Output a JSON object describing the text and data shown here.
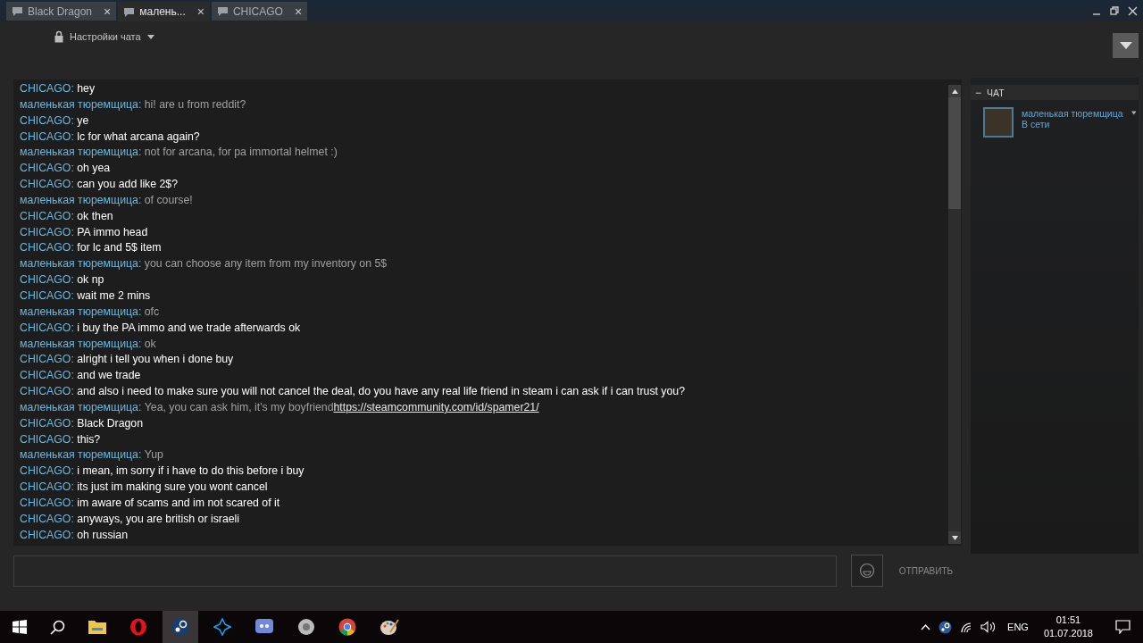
{
  "tabs": [
    {
      "label": "Black Dragon",
      "selected": false,
      "close": "×"
    },
    {
      "label": "малень...",
      "selected": true,
      "close": "×"
    },
    {
      "label": "CHICAGO",
      "selected": false,
      "close": "×"
    }
  ],
  "chat_settings": {
    "label": "Настройки чата"
  },
  "messages": [
    {
      "sender": "CHICAGO:",
      "kind": "incoming",
      "text": "hey"
    },
    {
      "sender": "маленькая тюремщица:",
      "kind": "outgoing",
      "text": "hi! are u from reddit?"
    },
    {
      "sender": "CHICAGO:",
      "kind": "incoming",
      "text": "ye"
    },
    {
      "sender": "CHICAGO:",
      "kind": "incoming",
      "text": "lc for what arcana again?"
    },
    {
      "sender": "маленькая тюремщица:",
      "kind": "outgoing",
      "text": "not for arcana, for pa immortal helmet :)"
    },
    {
      "sender": "CHICAGO:",
      "kind": "incoming",
      "text": "oh yea"
    },
    {
      "sender": "CHICAGO:",
      "kind": "incoming",
      "text": "can you add like 2$?"
    },
    {
      "sender": "маленькая тюремщица:",
      "kind": "outgoing",
      "text": "of course!"
    },
    {
      "sender": "CHICAGO:",
      "kind": "incoming",
      "text": "ok then"
    },
    {
      "sender": "CHICAGO:",
      "kind": "incoming",
      "text": "PA immo head"
    },
    {
      "sender": "CHICAGO:",
      "kind": "incoming",
      "text": "for lc and 5$ item"
    },
    {
      "sender": "маленькая тюремщица:",
      "kind": "outgoing",
      "text": "you can choose any item from my inventory on 5$"
    },
    {
      "sender": "CHICAGO:",
      "kind": "incoming",
      "text": "ok np"
    },
    {
      "sender": "CHICAGO:",
      "kind": "incoming",
      "text": "wait me 2 mins"
    },
    {
      "sender": "маленькая тюремщица:",
      "kind": "outgoing",
      "text": "ofc"
    },
    {
      "sender": "CHICAGO:",
      "kind": "incoming",
      "text": "i buy the PA immo and we trade afterwards ok"
    },
    {
      "sender": "маленькая тюремщица:",
      "kind": "outgoing",
      "text": "ok"
    },
    {
      "sender": "CHICAGO:",
      "kind": "incoming",
      "text": "alright i tell you when i done buy"
    },
    {
      "sender": "CHICAGO:",
      "kind": "incoming",
      "text": "and we trade"
    },
    {
      "sender": "CHICAGO:",
      "kind": "incoming",
      "text": "and also i need to make sure you will not cancel the deal, do you have any real life friend in steam i can ask if i can trust you?"
    },
    {
      "sender": "маленькая тюремщица:",
      "kind": "outgoing",
      "text": "Yea, you can ask him, it's my boyfriend",
      "link": "https://steamcommunity.com/id/spamer21/"
    },
    {
      "sender": "CHICAGO:",
      "kind": "incoming",
      "text": "Black Dragon"
    },
    {
      "sender": "CHICAGO:",
      "kind": "incoming",
      "text": "this?"
    },
    {
      "sender": "маленькая тюремщица:",
      "kind": "outgoing",
      "text": "Yup"
    },
    {
      "sender": "CHICAGO:",
      "kind": "incoming",
      "text": "i mean, im sorry if i have to do this before i buy"
    },
    {
      "sender": "CHICAGO:",
      "kind": "incoming",
      "text": "its just im making sure you wont cancel"
    },
    {
      "sender": "CHICAGO:",
      "kind": "incoming",
      "text": "im aware of scams and im not scared of it"
    },
    {
      "sender": "CHICAGO:",
      "kind": "incoming",
      "text": "anyways, you are british or israeli"
    },
    {
      "sender": "CHICAGO:",
      "kind": "incoming",
      "text": "oh russian"
    }
  ],
  "friends": {
    "group_label": "ЧАТ",
    "collapse": "−",
    "members": [
      {
        "name": "маленькая тюремщица",
        "status": "В сети"
      }
    ]
  },
  "composer": {
    "send_label": "ОТПРАВИТЬ"
  },
  "taskbar": {
    "language": "ENG",
    "time": "01:51",
    "date": "01.07.2018"
  }
}
